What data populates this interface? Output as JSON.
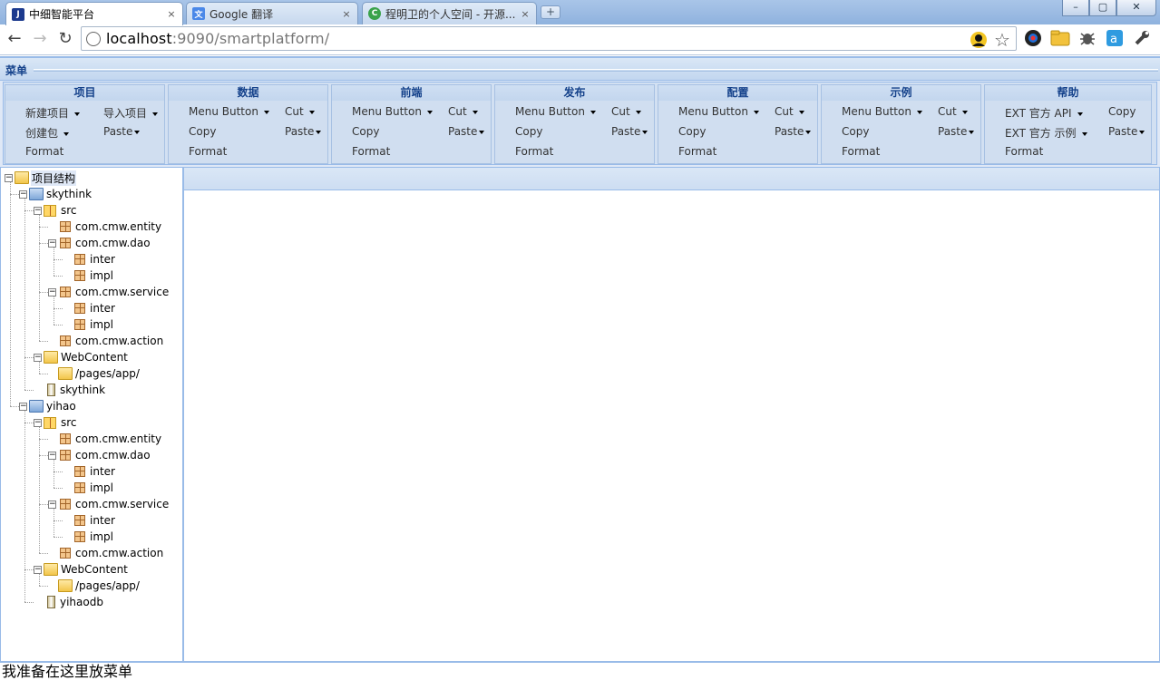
{
  "browser": {
    "tabs": [
      {
        "title": "中细智能平台",
        "favicon": "app-favicon",
        "active": true
      },
      {
        "title": "Google 翻译",
        "favicon": "google-translate-favicon",
        "active": false
      },
      {
        "title": "程明卫的个人空间 - 开源...",
        "favicon": "oschina-favicon",
        "active": false
      }
    ],
    "close_glyph": "×",
    "new_tab_glyph": "+",
    "window_buttons": {
      "minimize": "–",
      "maximize": "▢",
      "close": "✕"
    },
    "nav": {
      "back": "←",
      "forward": "→",
      "reload": "↻"
    },
    "url_host": "localhost",
    "url_rest": ":9090/smartplatform/",
    "star_glyph": "☆",
    "extension_icons": [
      "chrome-icon",
      "folder-icon",
      "bug-icon",
      "notes-icon",
      "wrench-icon"
    ]
  },
  "menu": {
    "title": "菜单",
    "groups": [
      {
        "title": "项目",
        "buttons": [
          {
            "label": "新建项目",
            "caret": true,
            "col": 0,
            "row": 0
          },
          {
            "label": "导入项目",
            "caret": true,
            "col": 1,
            "row": 0
          },
          {
            "label": "创建包",
            "caret": true,
            "col": 0,
            "row": 1
          },
          {
            "label": "Paste",
            "caret": true,
            "col": 1,
            "row": 1
          },
          {
            "label": "Format",
            "caret": false,
            "col": 0,
            "row": 2
          }
        ]
      },
      {
        "title": "数据",
        "buttons": [
          {
            "label": "Menu Button",
            "caret": true,
            "col": 0,
            "row": 0
          },
          {
            "label": "Cut",
            "caret": true,
            "col": 1,
            "row": 0
          },
          {
            "label": "Copy",
            "caret": false,
            "col": 0,
            "row": 1
          },
          {
            "label": "Paste",
            "caret": true,
            "col": 1,
            "row": 1
          },
          {
            "label": "Format",
            "caret": false,
            "col": 0,
            "row": 2
          }
        ]
      },
      {
        "title": "前端",
        "buttons": [
          {
            "label": "Menu Button",
            "caret": true,
            "col": 0,
            "row": 0
          },
          {
            "label": "Cut",
            "caret": true,
            "col": 1,
            "row": 0
          },
          {
            "label": "Copy",
            "caret": false,
            "col": 0,
            "row": 1
          },
          {
            "label": "Paste",
            "caret": true,
            "col": 1,
            "row": 1
          },
          {
            "label": "Format",
            "caret": false,
            "col": 0,
            "row": 2
          }
        ]
      },
      {
        "title": "发布",
        "buttons": [
          {
            "label": "Menu Button",
            "caret": true,
            "col": 0,
            "row": 0
          },
          {
            "label": "Cut",
            "caret": true,
            "col": 1,
            "row": 0
          },
          {
            "label": "Copy",
            "caret": false,
            "col": 0,
            "row": 1
          },
          {
            "label": "Paste",
            "caret": true,
            "col": 1,
            "row": 1
          },
          {
            "label": "Format",
            "caret": false,
            "col": 0,
            "row": 2
          }
        ]
      },
      {
        "title": "配置",
        "buttons": [
          {
            "label": "Menu Button",
            "caret": true,
            "col": 0,
            "row": 0
          },
          {
            "label": "Cut",
            "caret": true,
            "col": 1,
            "row": 0
          },
          {
            "label": "Copy",
            "caret": false,
            "col": 0,
            "row": 1
          },
          {
            "label": "Paste",
            "caret": true,
            "col": 1,
            "row": 1
          },
          {
            "label": "Format",
            "caret": false,
            "col": 0,
            "row": 2
          }
        ]
      },
      {
        "title": "示例",
        "buttons": [
          {
            "label": "Menu Button",
            "caret": true,
            "col": 0,
            "row": 0
          },
          {
            "label": "Cut",
            "caret": true,
            "col": 1,
            "row": 0
          },
          {
            "label": "Copy",
            "caret": false,
            "col": 0,
            "row": 1
          },
          {
            "label": "Paste",
            "caret": true,
            "col": 1,
            "row": 1
          },
          {
            "label": "Format",
            "caret": false,
            "col": 0,
            "row": 2
          }
        ]
      },
      {
        "title": "帮助",
        "buttons": [
          {
            "label": "EXT 官方 API",
            "caret": true,
            "col": 0,
            "row": 0
          },
          {
            "label": "Copy",
            "caret": false,
            "col": 1,
            "row": 0
          },
          {
            "label": "EXT 官方 示例",
            "caret": true,
            "col": 0,
            "row": 1
          },
          {
            "label": "Paste",
            "caret": true,
            "col": 1,
            "row": 1
          },
          {
            "label": "Format",
            "caret": false,
            "col": 0,
            "row": 2
          }
        ]
      }
    ]
  },
  "tree": {
    "nodes": [
      {
        "label": "项目结构",
        "depth": 0,
        "icon": "folder-open-icon",
        "toggle": "−",
        "selected": true
      },
      {
        "label": "skythink",
        "depth": 1,
        "icon": "project-folder-icon",
        "toggle": "−"
      },
      {
        "label": "src",
        "depth": 2,
        "icon": "source-folder-icon",
        "toggle": "−"
      },
      {
        "label": "com.cmw.entity",
        "depth": 3,
        "icon": "package-icon",
        "toggle": ""
      },
      {
        "label": "com.cmw.dao",
        "depth": 3,
        "icon": "package-icon",
        "toggle": "−"
      },
      {
        "label": "inter",
        "depth": 4,
        "icon": "package-icon",
        "toggle": ""
      },
      {
        "label": "impl",
        "depth": 4,
        "icon": "package-icon",
        "toggle": ""
      },
      {
        "label": "com.cmw.service",
        "depth": 3,
        "icon": "package-icon",
        "toggle": "−"
      },
      {
        "label": "inter",
        "depth": 4,
        "icon": "package-icon",
        "toggle": ""
      },
      {
        "label": "impl",
        "depth": 4,
        "icon": "package-icon",
        "toggle": ""
      },
      {
        "label": "com.cmw.action",
        "depth": 3,
        "icon": "package-icon",
        "toggle": ""
      },
      {
        "label": "WebContent",
        "depth": 2,
        "icon": "folder-open-icon",
        "toggle": "−"
      },
      {
        "label": "/pages/app/",
        "depth": 3,
        "icon": "folder-open-icon",
        "toggle": ""
      },
      {
        "label": "skythink",
        "depth": 2,
        "icon": "jar-icon",
        "toggle": ""
      },
      {
        "label": "yihao",
        "depth": 1,
        "icon": "project-folder-icon",
        "toggle": "−"
      },
      {
        "label": "src",
        "depth": 2,
        "icon": "source-folder-icon",
        "toggle": "−"
      },
      {
        "label": "com.cmw.entity",
        "depth": 3,
        "icon": "package-icon",
        "toggle": ""
      },
      {
        "label": "com.cmw.dao",
        "depth": 3,
        "icon": "package-icon",
        "toggle": "−"
      },
      {
        "label": "inter",
        "depth": 4,
        "icon": "package-icon",
        "toggle": ""
      },
      {
        "label": "impl",
        "depth": 4,
        "icon": "package-icon",
        "toggle": ""
      },
      {
        "label": "com.cmw.service",
        "depth": 3,
        "icon": "package-icon",
        "toggle": "−"
      },
      {
        "label": "inter",
        "depth": 4,
        "icon": "package-icon",
        "toggle": ""
      },
      {
        "label": "impl",
        "depth": 4,
        "icon": "package-icon",
        "toggle": ""
      },
      {
        "label": "com.cmw.action",
        "depth": 3,
        "icon": "package-icon",
        "toggle": ""
      },
      {
        "label": "WebContent",
        "depth": 2,
        "icon": "folder-open-icon",
        "toggle": "−"
      },
      {
        "label": "/pages/app/",
        "depth": 3,
        "icon": "folder-open-icon",
        "toggle": ""
      },
      {
        "label": "yihaodb",
        "depth": 2,
        "icon": "jar-icon",
        "toggle": ""
      }
    ]
  },
  "footer": {
    "text": "我准备在这里放菜单"
  },
  "colors": {
    "header_text": "#15428b",
    "border": "#99bbe8",
    "panel_bg": "#dfe8f6"
  }
}
